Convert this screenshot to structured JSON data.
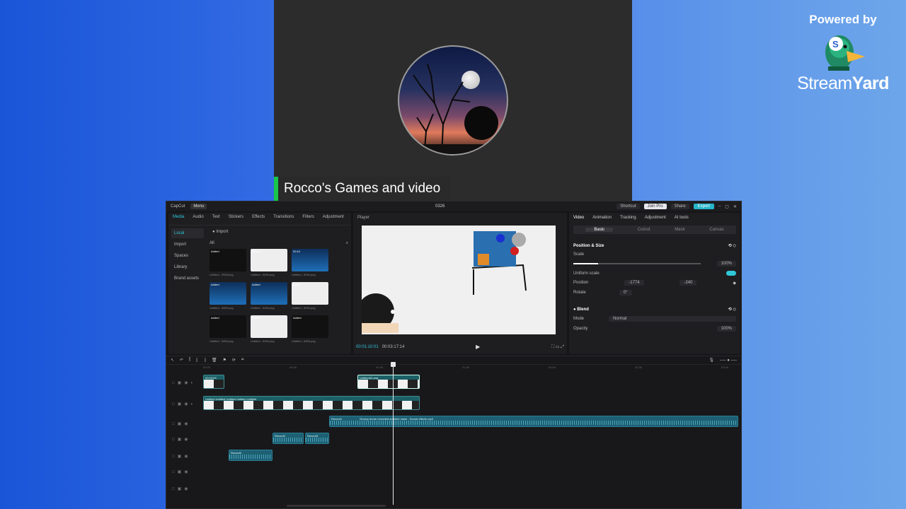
{
  "stream": {
    "name_tag": "Rocco's Games and video",
    "powered_by": "Powered by",
    "brand_stream": "Stream",
    "brand_yard": "Yard"
  },
  "capcut": {
    "app_name": "CapCut",
    "menu": "Menu",
    "project_title": "0326",
    "titlebar": {
      "shortcut": "Shortcut",
      "join_pro": "Join Pro",
      "share": "Share",
      "export": "Export"
    },
    "media_tools": [
      "Media",
      "Audio",
      "Text",
      "Stickers",
      "Effects",
      "Transitions",
      "Filters",
      "Adjustment"
    ],
    "media_side": [
      "Local",
      "Import",
      "Spaces",
      "Library",
      "Brand assets"
    ],
    "import_label": "Import",
    "all_label": "All",
    "thumbs": [
      {
        "badge": "Added",
        "cap": "Untitled...2908.png",
        "style": "t-dark"
      },
      {
        "badge": "Added",
        "cap": "Untitled...3030.png",
        "style": "t-light"
      },
      {
        "badge": "00:10",
        "cap": "Untitled...3030.png",
        "style": "t-wave"
      },
      {
        "badge": "Added",
        "cap": "Untitled...3455.png",
        "style": "t-wave"
      },
      {
        "badge": "Added",
        "cap": "Untitled...3455.png",
        "style": "t-wave"
      },
      {
        "badge": "Added",
        "cap": "Untitled...3030.png",
        "style": "t-light"
      },
      {
        "badge": "Added",
        "cap": "Untitled...3455.png",
        "style": "t-dark"
      },
      {
        "badge": "Added",
        "cap": "Untitled...3455.png",
        "style": "t-light"
      },
      {
        "badge": "Added",
        "cap": "Untitled...3455.png",
        "style": "t-dark"
      }
    ],
    "player": {
      "label": "Player",
      "timecode": "00:01:10:01",
      "duration": "00:03:17:14"
    },
    "props_tabs": [
      "Video",
      "Animation",
      "Tracking",
      "Adjustment",
      "AI tools"
    ],
    "props_subtabs": [
      "Basic",
      "Cutout",
      "Mask",
      "Canvas"
    ],
    "position_size": "Position & Size",
    "scale_label": "Scale",
    "scale_value": "100%",
    "uniform_scale": "Uniform scale",
    "position_label": "Position",
    "pos_x": "-1774",
    "pos_y": "-240",
    "rotate_label": "Rotate",
    "rotate_value": "0°",
    "blend_label": "Blend",
    "mode_label": "Mode",
    "mode_value": "Normal",
    "opacity_label": "Opacity",
    "opacity_value": "100%",
    "ruler": [
      "00:00",
      "00:30",
      "01:00",
      "01:30",
      "02:00",
      "02:30",
      "03:00"
    ],
    "clips": {
      "c1": "00:03:09",
      "c2": "Untitled",
      "c3": "Untitled(2).png",
      "main": "Untitled Untitled Untitled Untitled Untitled",
      "record1": "Record1",
      "record1_sub": "Groovy drone recorded ambient noise - Sound effects mp3",
      "record2": "Record2",
      "record3": "Record3",
      "record4": "Record4"
    }
  }
}
